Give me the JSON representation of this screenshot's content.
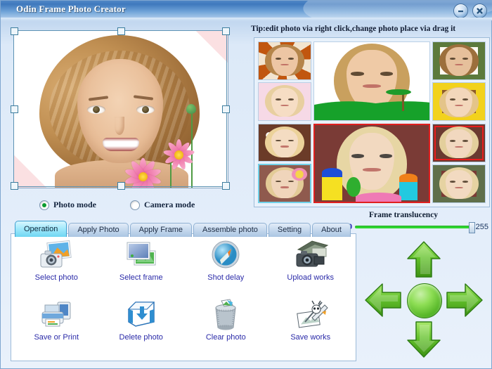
{
  "window": {
    "title": "Odin Frame Photo Creator",
    "minimize_icon": "minimize-icon",
    "close_icon": "close-icon"
  },
  "tip": {
    "text": "Tip:edit photo via right click,change photo place via drag it"
  },
  "modes": {
    "photo": {
      "label": "Photo mode",
      "selected": true
    },
    "camera": {
      "label": "Camera mode",
      "selected": false
    }
  },
  "tabs": [
    {
      "label": "Operation",
      "active": true
    },
    {
      "label": "Apply Photo",
      "active": false
    },
    {
      "label": "Apply Frame",
      "active": false
    },
    {
      "label": "Assemble photo",
      "active": false
    },
    {
      "label": "Setting",
      "active": false
    },
    {
      "label": "About",
      "active": false
    }
  ],
  "actions": [
    {
      "label": "Select photo",
      "icon": "camera-photo-icon"
    },
    {
      "label": "Select frame",
      "icon": "picture-frame-icon"
    },
    {
      "label": "Shot delay",
      "icon": "compass-timer-icon"
    },
    {
      "label": "Upload works",
      "icon": "upload-camera-icon"
    },
    {
      "label": "Save or Print",
      "icon": "printer-icon"
    },
    {
      "label": "Delete photo",
      "icon": "delete-box-icon"
    },
    {
      "label": "Clear photo",
      "icon": "trash-bin-icon"
    },
    {
      "label": "Save works",
      "icon": "save-works-icon"
    }
  ],
  "translucency": {
    "title": "Frame translucency",
    "min": "0",
    "max": "255",
    "value": 255
  },
  "pad": {
    "up": "arrow-up-icon",
    "down": "arrow-down-icon",
    "left": "arrow-left-icon",
    "right": "arrow-right-icon",
    "center": "center-button"
  },
  "colors": {
    "titlebar": "#3f79bd",
    "active_tab": "#6fd6f2",
    "slider_track": "#2fd62f",
    "label_blue": "#2a2aa8",
    "selection_red": "#e02020",
    "arrow_green": "#4fb122"
  },
  "gallery": {
    "rows": [
      {
        "left": [
          {
            "name": "thumb-orange-frame",
            "bg": "#c1560f",
            "hair": "#b5854a",
            "skin": "#edc6a4",
            "selected": false
          },
          {
            "name": "thumb-pink-flower-frame",
            "bg": "#f6d9e6",
            "hair": "#e8cfa0",
            "skin": "#f6ddc4",
            "selected": false
          }
        ],
        "center": {
          "name": "preview-green-hill-frame",
          "bg": "#ffffff",
          "hair": "#c9a05e",
          "skin": "#efcaa6",
          "selected": false
        },
        "right": [
          {
            "name": "thumb-green-leaf-frame",
            "bg": "#5c7a3c",
            "hair": "#9c6f3c",
            "skin": "#e6c09b",
            "selected": false
          },
          {
            "name": "thumb-yellow-flower-frame",
            "bg": "#f2d21c",
            "hair": "#e4c489",
            "skin": "#f3d7bb",
            "selected": false
          }
        ]
      },
      {
        "left": [
          {
            "name": "thumb-snowman-frame",
            "bg": "#6b3b28",
            "hair": "#ecd29a",
            "skin": "#f4dcc2",
            "selected": false
          },
          {
            "name": "thumb-cyan-flower-frame",
            "bg": "#8f5a4e",
            "hair": "#e3cb97",
            "skin": "#f0d5bb",
            "selected": true
          }
        ],
        "center": {
          "name": "preview-red-house-frame",
          "bg": "#7a3b36",
          "hair": "#e7d6a4",
          "skin": "#f2d9c0",
          "selected": true
        },
        "right": [
          {
            "name": "thumb-red-border-frame",
            "bg": "#6a3a30",
            "hair": "#e3cf9c",
            "skin": "#f1d8bf",
            "selected": false
          },
          {
            "name": "thumb-ivy-frame",
            "bg": "#5f6f4a",
            "hair": "#e6d3a2",
            "skin": "#f2dac1",
            "selected": false
          }
        ]
      }
    ]
  },
  "canvas": {
    "name": "photo-edit-canvas",
    "frame_color": "#fbe0e2",
    "handles": 8
  }
}
